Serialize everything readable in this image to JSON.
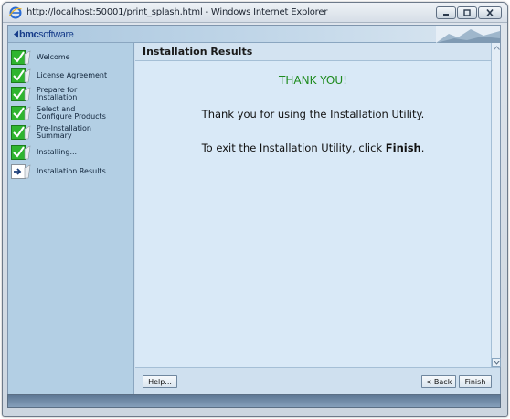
{
  "window": {
    "title": "http://localhost:50001/print_splash.html - Windows Internet Explorer"
  },
  "brand": {
    "logo_mark": "bmc",
    "logo_text": "software"
  },
  "sidebar": {
    "steps": [
      {
        "label": "Welcome",
        "state": "complete"
      },
      {
        "label": "License Agreement",
        "state": "complete"
      },
      {
        "label": "Prepare for\nInstallation",
        "state": "complete"
      },
      {
        "label": "Select and\nConfigure Products",
        "state": "complete"
      },
      {
        "label": "Pre-Installation\nSummary",
        "state": "complete"
      },
      {
        "label": "Installing...",
        "state": "complete"
      },
      {
        "label": "Installation Results",
        "state": "current"
      }
    ]
  },
  "main": {
    "title": "Installation Results",
    "heading": "THANK YOU!",
    "line1": "Thank you for using the Installation Utility.",
    "line2_prefix": "To exit the Installation Utility, click ",
    "line2_bold": "Finish",
    "line2_suffix": "."
  },
  "buttons": {
    "help": "Help...",
    "back": "< Back",
    "finish": "Finish"
  },
  "colors": {
    "heading_green": "#1d8a1d",
    "check_green": "#2fb52f",
    "sidebar_bg": "#b3cfe4",
    "main_bg": "#d9e9f7"
  }
}
